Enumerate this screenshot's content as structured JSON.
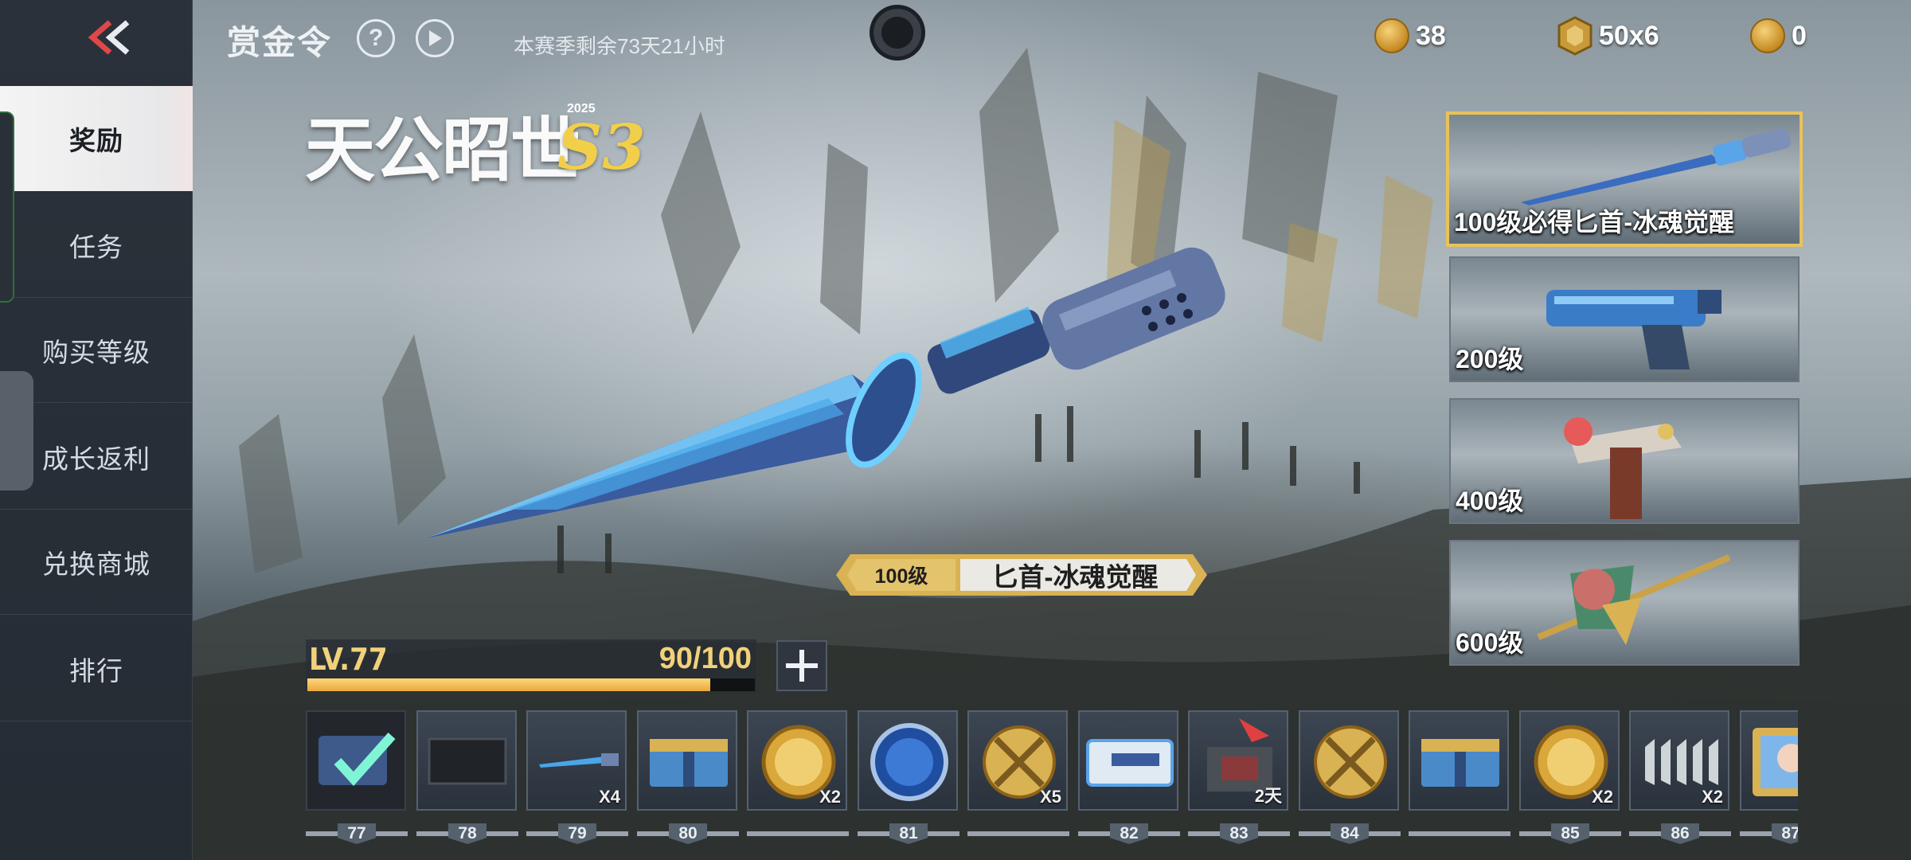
{
  "sidebar": {
    "back_icon": "double-chevron-left-icon",
    "items": [
      {
        "label": "奖励",
        "active": true
      },
      {
        "label": "任务",
        "active": false
      },
      {
        "label": "购买等级",
        "active": false
      },
      {
        "label": "成长返利",
        "active": false
      },
      {
        "label": "兑换商城",
        "active": false
      },
      {
        "label": "排行",
        "active": false
      }
    ]
  },
  "header": {
    "title": "赏金令",
    "help_icon": "question-icon",
    "play_icon": "play-icon",
    "season_remaining": "本赛季剩余73天21小时"
  },
  "currencies": [
    {
      "icon": "gold-coin-icon",
      "value": "38"
    },
    {
      "icon": "bounty-token-icon",
      "value": "50x6"
    },
    {
      "icon": "bounty-coin-add-icon",
      "value": "0"
    }
  ],
  "logo": {
    "text": "天公昭世",
    "season": "S3",
    "year": "2025"
  },
  "featured": {
    "level": "100级",
    "name": "匕首-冰魂觉醒",
    "icon": "ice-dagger"
  },
  "reward_cards": [
    {
      "label": "100级必得匕首-冰魂觉醒",
      "icon": "ice-dagger-icon",
      "selected": true
    },
    {
      "label": "200级",
      "icon": "blue-pistol-icon",
      "selected": false
    },
    {
      "label": "400级",
      "icon": "dragon-rifle-icon",
      "selected": false
    },
    {
      "label": "600级",
      "icon": "golden-halberd-icon",
      "selected": false
    }
  ],
  "level": {
    "label": "LV.77",
    "exp_text": "90/100",
    "exp_fraction": 0.9,
    "plus_icon": "plus-icon"
  },
  "track": [
    {
      "level": "77",
      "icon": "claimed-check-icon",
      "qty": ""
    },
    {
      "level": "78",
      "icon": "dark-card-icon",
      "qty": ""
    },
    {
      "level": "79",
      "icon": "dagger-icon",
      "qty": "X4"
    },
    {
      "level": "80",
      "icon": "supply-crate-icon",
      "qty": ""
    },
    {
      "level": "",
      "icon": "bounty-coin-icon",
      "qty": "X2"
    },
    {
      "level": "81",
      "icon": "exp-badge-icon",
      "qty": ""
    },
    {
      "level": "",
      "icon": "crossed-rifles-icon",
      "qty": "X5"
    },
    {
      "level": "82",
      "icon": "weapon-card-icon",
      "qty": ""
    },
    {
      "level": "83",
      "icon": "rebate-box-icon",
      "qty": "2天"
    },
    {
      "level": "84",
      "icon": "crossed-rifles-icon",
      "qty": ""
    },
    {
      "level": "",
      "icon": "supply-crate-icon",
      "qty": ""
    },
    {
      "level": "85",
      "icon": "bounty-coin-icon",
      "qty": "X2"
    },
    {
      "level": "86",
      "icon": "ammo-belt-icon",
      "qty": "X2"
    },
    {
      "level": "87",
      "icon": "character-card-icon",
      "qty": ""
    }
  ]
}
